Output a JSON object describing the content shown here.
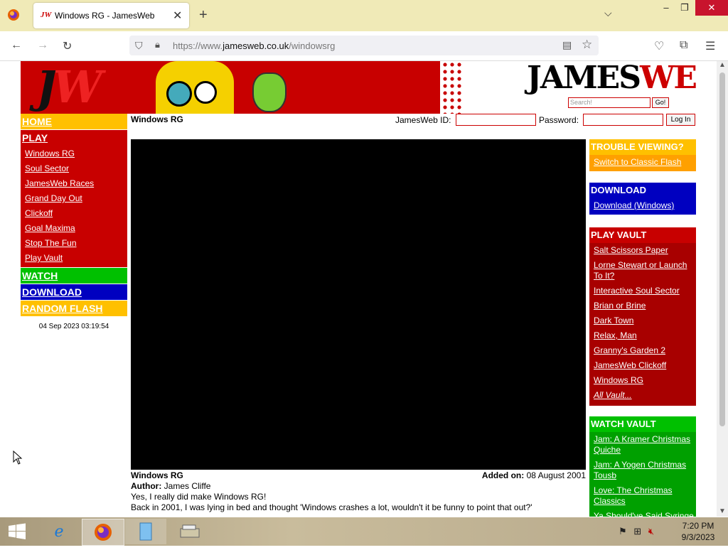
{
  "browser": {
    "tab_title": "Windows RG - JamesWeb",
    "tab_favicon": "JW",
    "new_tab_icon": "+",
    "tab_list_icon": "chevron-down-icon",
    "url_prefix": "https://www.",
    "url_domain": "jamesweb.co.uk",
    "url_path": "/windowsrg"
  },
  "site": {
    "banner_text_j": "J",
    "banner_text_w": "W",
    "logo_black": "JAMES",
    "logo_red": "WEB",
    "search_placeholder": "Search!",
    "search_button": "Go!"
  },
  "leftnav": {
    "home": "HOME",
    "play": "PLAY",
    "play_items": [
      "Windows RG",
      "Soul Sector",
      "JamesWeb Races",
      "Grand Day Out",
      "Clickoff",
      "Goal Maxima",
      "Stop The Fun",
      "Play Vault"
    ],
    "watch": "WATCH",
    "download": "DOWNLOAD",
    "random": "RANDOM FLASH",
    "clock": "04 Sep 2023 03:19:54"
  },
  "content": {
    "title": "Windows RG",
    "login_id_label": "JamesWeb ID:",
    "login_pw_label": "Password:",
    "login_button": "Log In",
    "info_title": "Windows RG",
    "added_label": "Added on:",
    "added_date": "08 August 2001",
    "author_label": "Author:",
    "author": "James Cliffe",
    "desc_line1": "Yes, I really did make Windows RG!",
    "desc_line2": "Back in 2001, I was lying in bed and thought 'Windows crashes a lot, wouldn't it be funny to point that out?'"
  },
  "rightcol": {
    "trouble_head": "TROUBLE VIEWING?",
    "trouble_link": "Switch to Classic Flash",
    "download_head": "DOWNLOAD",
    "download_link": "Download (Windows)",
    "playvault_head": "PLAY VAULT",
    "playvault_items": [
      "Salt Scissors Paper",
      "Lorne Stewart or Launch To It?",
      "Interactive Soul Sector",
      "Brian or Brine",
      "Dark Town",
      "Relax, Man",
      "Granny's Garden 2",
      "JamesWeb Clickoff",
      "Windows RG",
      "All Vault..."
    ],
    "watchvault_head": "WATCH VAULT",
    "watchvault_items": [
      "Jam: A Kramer Christmas Quiche",
      "Jam: A Yogen Christmas Tousb",
      "Love: The Christmas Classics",
      "Ya Should've Said Syringe"
    ]
  },
  "taskbar": {
    "time": "7:20 PM",
    "date": "9/3/2023"
  },
  "colors": {
    "red": "#c80000",
    "yellow": "#ffc000",
    "green": "#00c000",
    "blue": "#0000c0"
  }
}
